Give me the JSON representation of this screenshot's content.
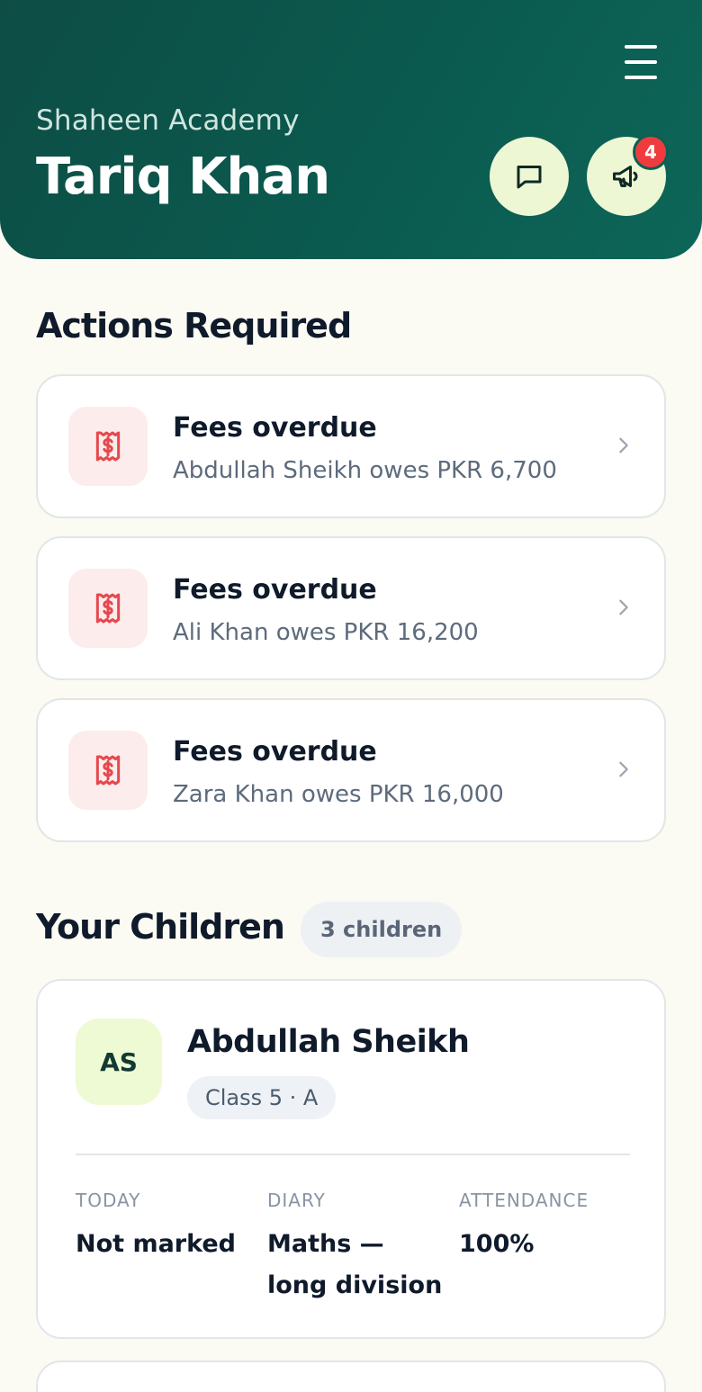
{
  "header": {
    "school_name": "Shaheen Academy",
    "user_name": "Tariq Khan",
    "notification_count": "4",
    "icons": [
      "menu-icon",
      "chat-icon",
      "megaphone-icon"
    ]
  },
  "actions": {
    "title": "Actions Required",
    "items": [
      {
        "title": "Fees overdue",
        "subtitle": "Abdullah Sheikh owes PKR 6,700",
        "icon": "receipt-dollar-icon"
      },
      {
        "title": "Fees overdue",
        "subtitle": "Ali Khan owes PKR 16,200",
        "icon": "receipt-dollar-icon"
      },
      {
        "title": "Fees overdue",
        "subtitle": "Zara Khan owes PKR 16,000",
        "icon": "receipt-dollar-icon"
      }
    ]
  },
  "children": {
    "title": "Your Children",
    "count_label": "3 children",
    "items": [
      {
        "initials": "AS",
        "name": "Abdullah Sheikh",
        "class_label": "Class 5 · A",
        "stats": [
          {
            "label": "TODAY",
            "value": "Not marked"
          },
          {
            "label": "DIARY",
            "value": "Maths — long division"
          },
          {
            "label": "ATTENDANCE",
            "value": "100%"
          }
        ]
      }
    ]
  },
  "colors": {
    "header_bg": "#0b5a4f",
    "accent_soft": "#eef7d4",
    "badge": "#ef3b3e",
    "alert_icon": "#e5484d",
    "page_bg": "#fbfaf3"
  }
}
